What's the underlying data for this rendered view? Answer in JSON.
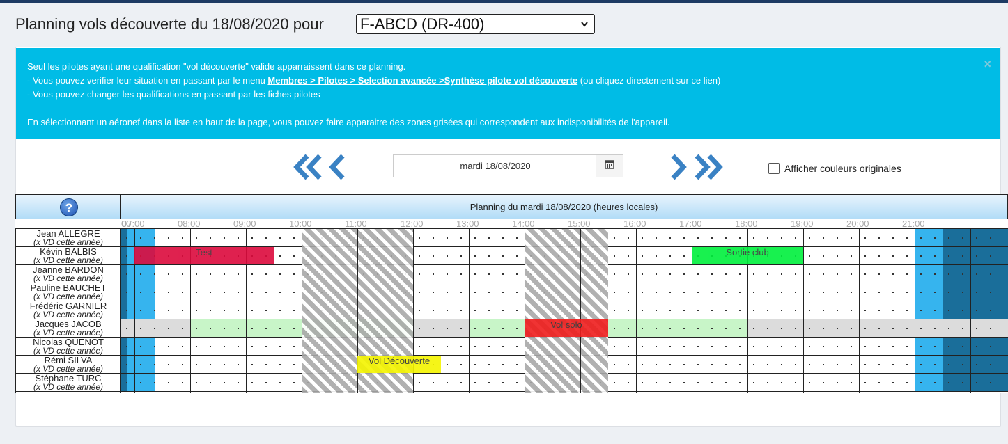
{
  "page": {
    "title": "Planning vols découverte du 18/08/2020 pour",
    "aircraft_select": "F-ABCD (DR-400)"
  },
  "alert": {
    "line1": "Seul les pilotes ayant une qualification \"vol découverte\" valide apparraissent dans ce planning.",
    "line2_pre": "- Vous pouvez verifier leur situation en passant par le menu ",
    "line2_link": "Membres > Pilotes > Selection avancée >Synthèse pilote vol découverte",
    "line2_post": " (ou cliquez directement sur ce lien)",
    "line3": "- Vous pouvez changer les qualifications en passant par les fiches pilotes",
    "line4": "En sélectionnant un aéronef dans la liste en haut de la page, vous pouvez faire apparaitre des zones grisées qui correspondent aux indisponibilités de l'appareil.",
    "close": "×"
  },
  "toolbar": {
    "prev_week": "«",
    "prev_day": "‹",
    "next_day": "›",
    "next_week": "»",
    "date_value": "mardi 18/08/2020",
    "calendar_icon": "calendar-icon",
    "original_colors_label": "Afficher couleurs originales"
  },
  "planning": {
    "header": "Planning du mardi 18/08/2020 (heures locales)",
    "help": "?",
    "hours": [
      "00",
      "07:00",
      "08:00",
      "09:00",
      "10:00",
      "11:00",
      "12:00",
      "13:00",
      "14:00",
      "15:00",
      "16:00",
      "17:00",
      "18:00",
      "19:00",
      "20:00",
      "21:00"
    ],
    "pilots": [
      {
        "name": "Jean ALLEGRE",
        "sub": "(x VD cette année)"
      },
      {
        "name": "Kévin BALBIS",
        "sub": "(x VD cette année)"
      },
      {
        "name": "Jeanne BARDON",
        "sub": "(x VD cette année)"
      },
      {
        "name": "Pauline BAUCHET",
        "sub": "(x VD cette année)"
      },
      {
        "name": "Frédéric GARNIER",
        "sub": "(x VD cette année)"
      },
      {
        "name": "Jacques JACOB",
        "sub": "(x VD cette année)"
      },
      {
        "name": "Nicolas QUENOT",
        "sub": "(x VD cette année)"
      },
      {
        "name": "Rémi SILVA",
        "sub": "(x VD cette année)"
      },
      {
        "name": "Stéphane TURC",
        "sub": "(x VD cette année)"
      }
    ],
    "events": [
      {
        "pilot": 1,
        "label": "Test",
        "start": "07:00",
        "end": "09:30",
        "color": "#dc0a3c"
      },
      {
        "pilot": 1,
        "label": "Sortie club",
        "start": "17:00",
        "end": "19:00",
        "color": "#00f03c"
      },
      {
        "pilot": 5,
        "label": "Vol solo",
        "start": "14:00",
        "end": "15:30",
        "color": "#f01e1e"
      },
      {
        "pilot": 7,
        "label": "Vol Découverte",
        "start": "11:00",
        "end": "12:30",
        "color": "#f5f500"
      }
    ],
    "unavailable": [
      {
        "start": "10:00",
        "end": "12:00"
      },
      {
        "start": "14:00",
        "end": "15:30"
      }
    ],
    "colors": {
      "night": "#1a6e9a",
      "twilight": "#36b4ee",
      "available": "#c8f5c8",
      "unavailable_pilot": "#dcdcdc",
      "header_gradient": "#b2dcf7",
      "alert": "#00bce6"
    }
  }
}
